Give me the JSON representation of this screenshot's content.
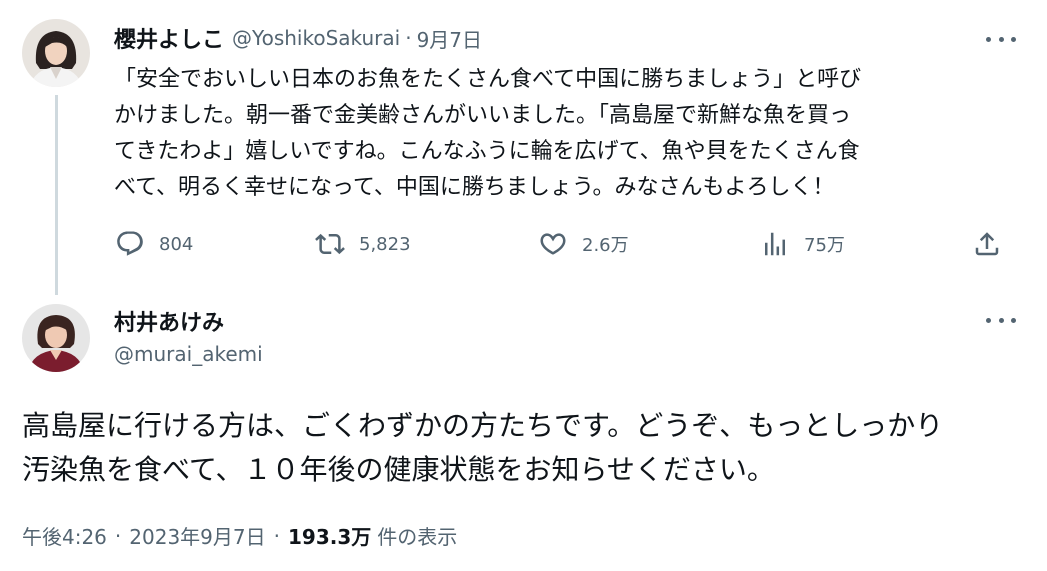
{
  "tweet1": {
    "name": "櫻井よしこ",
    "handle": "@YoshikoSakurai",
    "separator": "·",
    "date": "9月7日",
    "text_lines": [
      "「安全でおいしい日本のお魚をたくさん食べて中国に勝ちましょう」と呼び",
      "かけました。朝一番で金美齢さんがいいました。「高島屋で新鮮な魚を買っ",
      "てきたわよ」嬉しいですね。こんなふうに輪を広げて、魚や貝をたくさん食",
      "べて、明るく幸せになって、中国に勝ちましょう。みなさんもよろしく！"
    ],
    "replies": "804",
    "retweets": "5,823",
    "likes": "2.6万",
    "views": "75万"
  },
  "tweet2": {
    "name": "村井あけみ",
    "handle": "@murai_akemi",
    "text_lines": [
      "高島屋に行ける方は、ごくわずかの方たちです。どうぞ、もっとしっかり",
      "汚染魚を食べて、１０年後の健康状態をお知らせください。"
    ],
    "time": "午後4:26",
    "separator": "·",
    "date": "2023年9月7日",
    "views_count": "193.3万",
    "views_label": "件の表示"
  },
  "icons": {
    "reply": "reply-icon",
    "retweet": "retweet-icon",
    "like": "like-icon",
    "views": "views-icon",
    "share": "share-icon",
    "more": "more-icon"
  },
  "colors": {
    "text": "#0f1419",
    "secondary": "#536471",
    "thread_line": "#cfd9de"
  }
}
